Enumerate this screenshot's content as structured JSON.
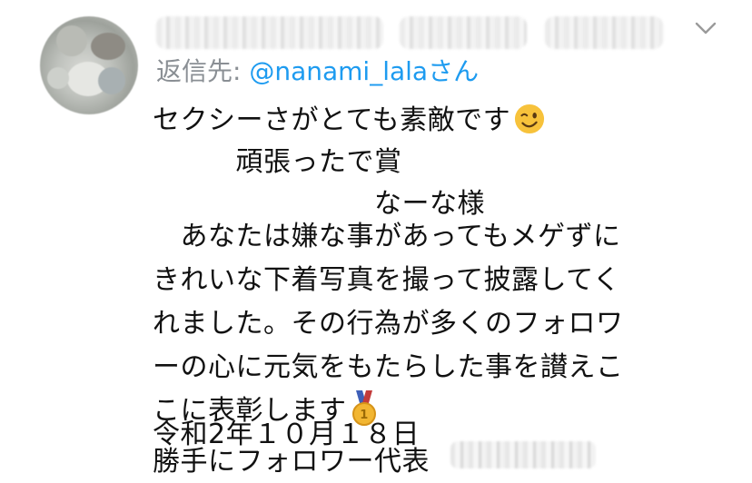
{
  "header": {
    "avatar_icon": "blurred-avatar-icon",
    "chevron_icon": "chevron-down-icon",
    "chevron_glyph": "⌄"
  },
  "reply": {
    "label": "返信先: ",
    "handle": "@nanami_lala",
    "suffix": "さん"
  },
  "body": {
    "lines": [
      "セクシーさがとても素敵です",
      "　　　頑張ったで賞",
      "　　　　　　　　なーな様",
      "　あなたは嫌な事があってもメゲずに",
      "きれいな下着写真を撮って披露してく",
      "れました。その行為が多くのフォロワ",
      "ーの心に元気をもたらした事を讃えこ",
      "こに表彰します",
      "令和2年１０月１８日",
      "勝手にフォロワー代表"
    ],
    "wink_icon": "winking-face-icon",
    "medal_icon": "gold-medal-icon"
  },
  "colors": {
    "link": "#1d9bf0",
    "muted": "#8a8f94",
    "text": "#111111",
    "medal": "#f2b632",
    "wink": "#f7c23b"
  }
}
